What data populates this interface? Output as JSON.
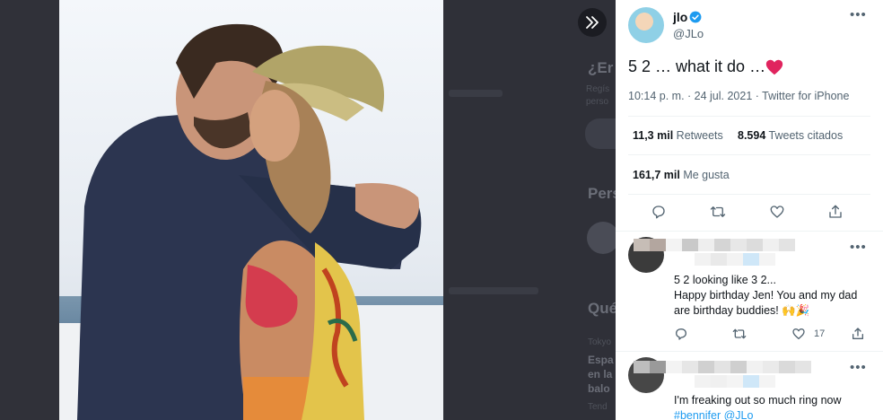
{
  "background": {
    "heading_1": "¿Er",
    "sub_1": "Regís",
    "sub_1b": "perso",
    "heading_2": "Pers",
    "heading_3": "Qué",
    "sub_3": "Tokyo",
    "bold_lines": [
      "Espa",
      "en la",
      "balo"
    ],
    "sub_bottom": "Tend"
  },
  "tweet": {
    "name": "jlo",
    "handle": "@JLo",
    "text": "5  2 … what it do …",
    "time": "10:14 p. m. · 24 jul. 2021 · Twitter for iPhone",
    "retweets_count": "11,3 mil",
    "retweets_label": "Retweets",
    "quotes_count": "8.594",
    "quotes_label": "Tweets citados",
    "likes_count": "161,7 mil",
    "likes_label": "Me gusta"
  },
  "replies": [
    {
      "lines": [
        "5 2 looking like 3 2...",
        "Happy birthday Jen! You and my dad",
        "are birthday buddies! 🙌🎉"
      ],
      "like_count": "17"
    },
    {
      "line1": "I'm freaking out so much ring now",
      "hashtag": "#bennifer",
      "mention": "@JLo"
    }
  ],
  "icons": {
    "expand": "double-chevron-right-icon",
    "more": "more-horizontal-icon",
    "verified": "verified-badge-icon",
    "reply": "reply-icon",
    "retweet": "retweet-icon",
    "like": "heart-icon",
    "share": "share-icon"
  },
  "colors": {
    "accent": "#1d9bf0",
    "heart": "#e0245e"
  }
}
